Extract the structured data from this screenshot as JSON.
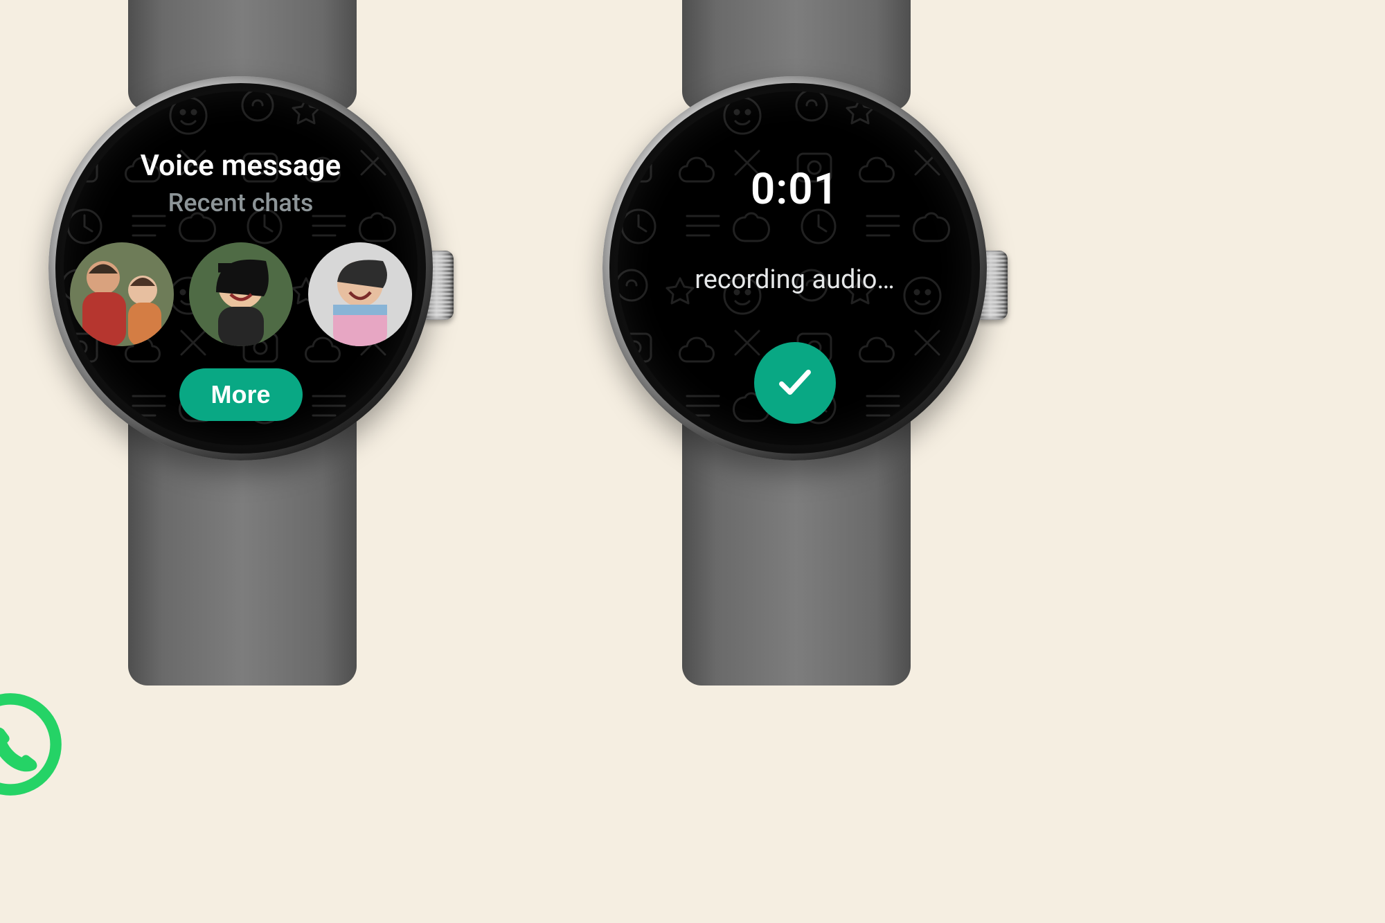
{
  "colors": {
    "accent": "#09a884",
    "muted": "#8d9598"
  },
  "left_screen": {
    "title": "Voice message",
    "subtitle": "Recent chats",
    "avatars": [
      {
        "name": "contact-1"
      },
      {
        "name": "contact-2"
      },
      {
        "name": "contact-3"
      }
    ],
    "more_label": "More"
  },
  "right_screen": {
    "timer": "0:01",
    "status": "recording audio…",
    "confirm_icon": "checkmark-icon"
  },
  "brand_icon": "whatsapp-icon"
}
